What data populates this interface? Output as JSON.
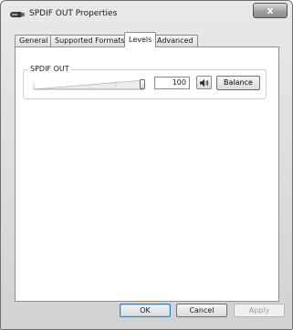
{
  "window": {
    "title": "SPDIF OUT Properties",
    "close_glyph": "x",
    "icon": "speaker-icon"
  },
  "tabs": [
    {
      "label": "General",
      "active": false
    },
    {
      "label": "Supported Formats",
      "active": false
    },
    {
      "label": "Levels",
      "active": true
    },
    {
      "label": "Advanced",
      "active": false
    }
  ],
  "levels": {
    "group_label": "SPDIF OUT",
    "slider_level_percent": 100,
    "value": "100",
    "mute_icon": "speaker-volume-icon",
    "balance_label": "Balance"
  },
  "footer": {
    "ok_label": "OK",
    "cancel_label": "Cancel",
    "apply_label": "Apply",
    "apply_enabled": false
  },
  "colors": {
    "default_button_border": "#3c7fb1",
    "disabled_text": "#9a9a9a"
  }
}
